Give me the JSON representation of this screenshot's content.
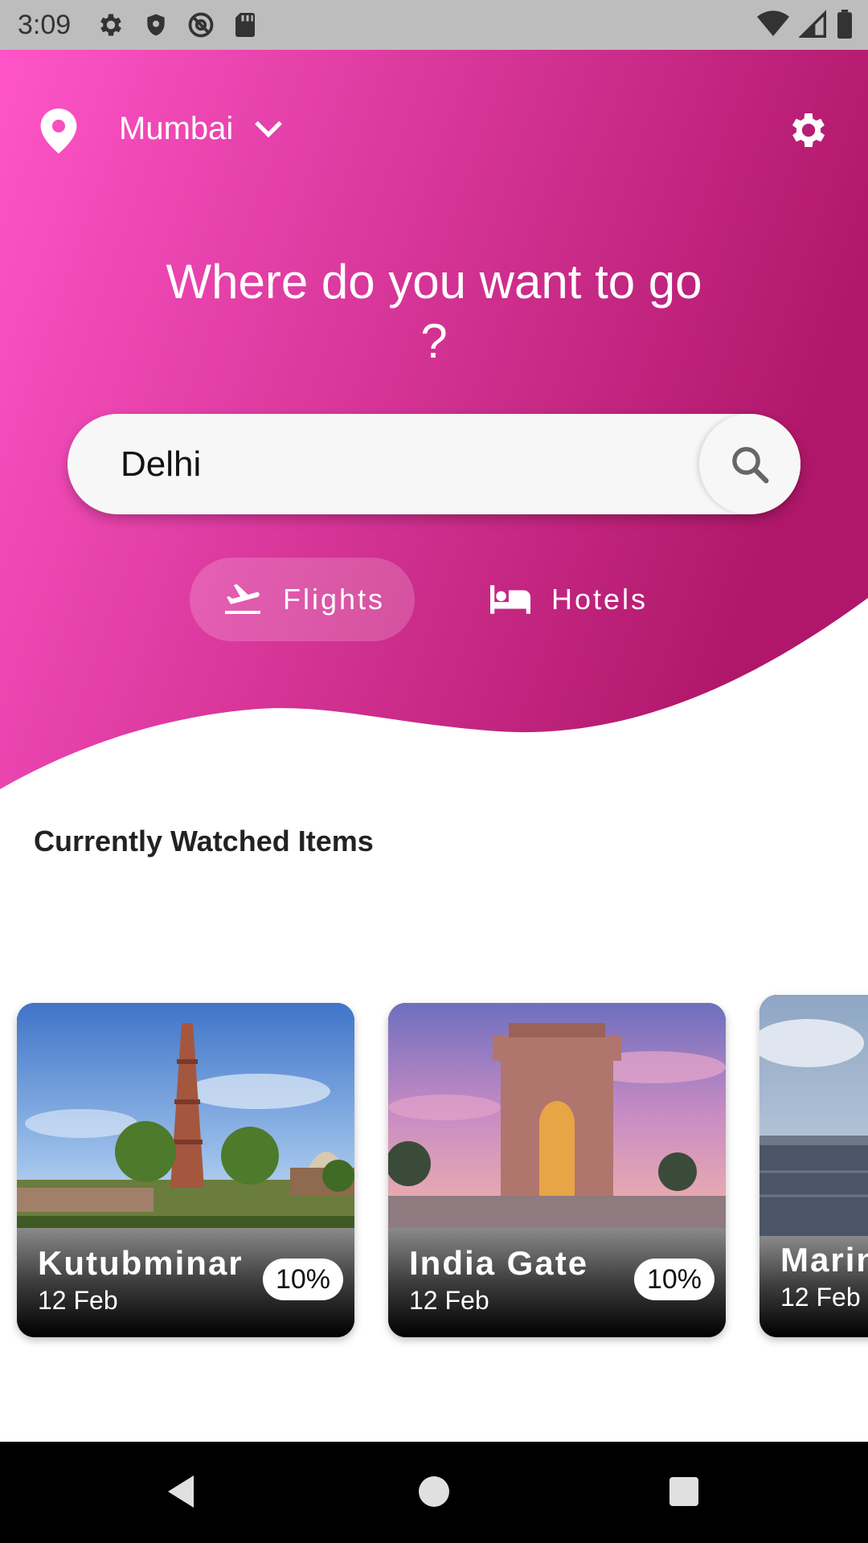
{
  "status_bar": {
    "time": "3:09",
    "left_icons": [
      "gear-icon",
      "shield-icon",
      "at-sign-icon",
      "sd-card-icon"
    ],
    "right_icons": [
      "wifi-icon",
      "signal-icon",
      "battery-icon"
    ]
  },
  "header": {
    "location": "Mumbai",
    "location_icon": "location-pin-icon",
    "dropdown_icon": "chevron-down-icon",
    "settings_icon": "gear-icon"
  },
  "hero": {
    "headline": "Where do you want to go ?",
    "gradient_colors": [
      "#ff55c8",
      "#b0176a"
    ]
  },
  "search": {
    "value": "Delhi",
    "icon": "search-icon"
  },
  "tabs": [
    {
      "label": "Flights",
      "icon": "flight-takeoff-icon",
      "selected": true
    },
    {
      "label": "Hotels",
      "icon": "bed-icon",
      "selected": false
    }
  ],
  "section": {
    "title": "Currently Watched Items"
  },
  "cards": [
    {
      "name": "Kutubminar",
      "date": "12 Feb",
      "discount": "10%"
    },
    {
      "name": "India Gate",
      "date": "12 Feb",
      "discount": "10%"
    },
    {
      "name": "Marin",
      "date": "12 Feb",
      "discount": ""
    }
  ],
  "nav_bar": {
    "buttons": [
      "back-icon",
      "home-icon",
      "recents-icon"
    ]
  }
}
